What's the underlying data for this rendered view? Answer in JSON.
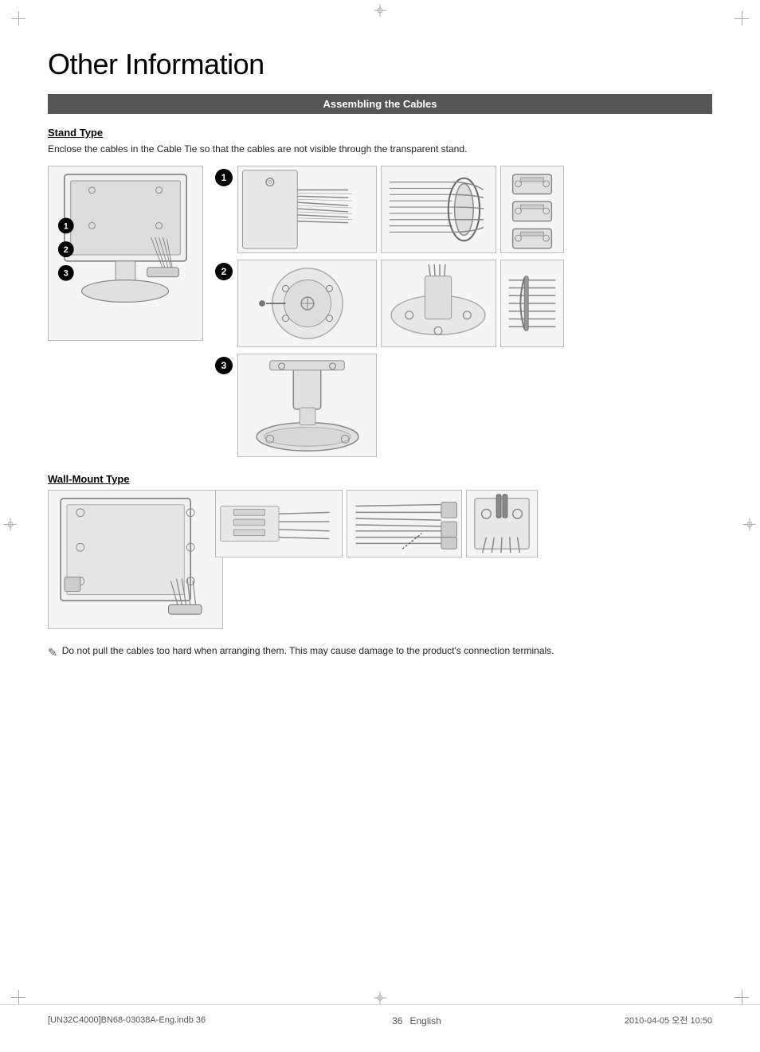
{
  "page": {
    "title": "Other Information",
    "section_header": "Assembling the Cables",
    "stand_type": {
      "label": "Stand Type",
      "description": "Enclose the cables in the Cable Tie so that the cables are not visible through the transparent stand."
    },
    "wall_mount_type": {
      "label": "Wall-Mount Type"
    },
    "note": {
      "text": "Do not pull the cables too hard when arranging them. This may cause damage to the product's connection terminals."
    },
    "footer": {
      "file": "[UN32C4000]BN68-03038A-Eng.indb   36",
      "date": "2010-04-05   오전 10:50",
      "page_number": "36",
      "page_label": "English"
    }
  }
}
